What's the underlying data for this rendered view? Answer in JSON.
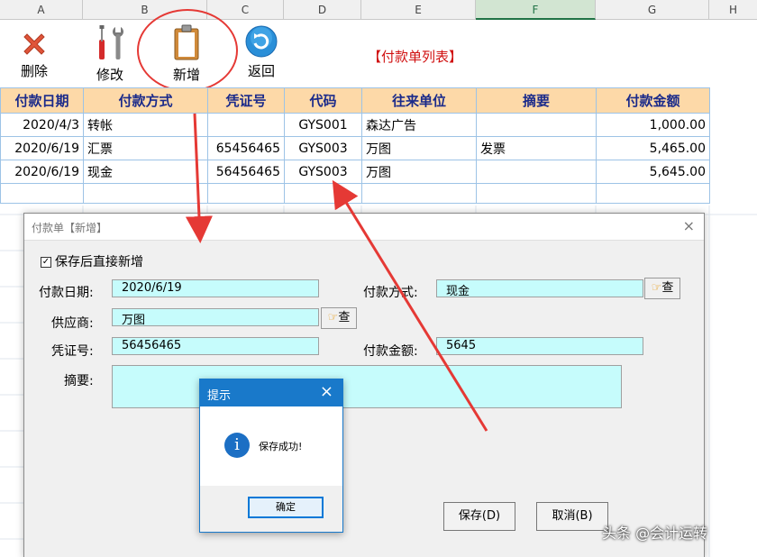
{
  "sheet": {
    "columns": [
      "A",
      "B",
      "C",
      "D",
      "E",
      "F",
      "G",
      "H"
    ],
    "selected_column": "F"
  },
  "toolbar": {
    "delete_label": "删除",
    "edit_label": "修改",
    "add_label": "新增",
    "back_label": "返回"
  },
  "list_title": "【付款单列表】",
  "table": {
    "headers": [
      "付款日期",
      "付款方式",
      "凭证号",
      "代码",
      "往来单位",
      "摘要",
      "付款金额"
    ],
    "rows": [
      [
        "2020/4/3",
        "转帐",
        "",
        "GYS001",
        "森达广告",
        "",
        "1,000.00"
      ],
      [
        "2020/6/19",
        "汇票",
        "65456465",
        "GYS003",
        "万图",
        "发票",
        "5,465.00"
      ],
      [
        "2020/6/19",
        "现金",
        "56456465",
        "GYS003",
        "万图",
        "",
        "5,645.00"
      ]
    ]
  },
  "form_dialog": {
    "title": "付款单【新增】",
    "close": "×",
    "check_mark": "✓",
    "save_new_checkbox": "保存后直接新增",
    "date_label": "付款日期:",
    "date_value": "2020/6/19",
    "method_label": "付款方式:",
    "method_value": "现金",
    "supplier_label": "供应商:",
    "supplier_value": "万图",
    "voucher_label": "凭证号:",
    "voucher_value": "56456465",
    "amount_label": "付款金额:",
    "amount_value": "5645",
    "summary_label": "摘要:",
    "summary_value": "",
    "lookup_label": "查",
    "save_button": "保存(D)",
    "cancel_button": "取消(B)"
  },
  "message_box": {
    "title": "提示",
    "close": "×",
    "icon": "i",
    "message": "保存成功!",
    "ok_button": "确定"
  },
  "watermark": "头条 @会计运转",
  "colors": {
    "header_bg": "#fdd9a8",
    "header_text": "#1a2a8a",
    "input_bg": "#c6fcfc",
    "annotation_red": "#e53935",
    "title_red": "#d01010",
    "msgbox_blue": "#1979ca"
  }
}
